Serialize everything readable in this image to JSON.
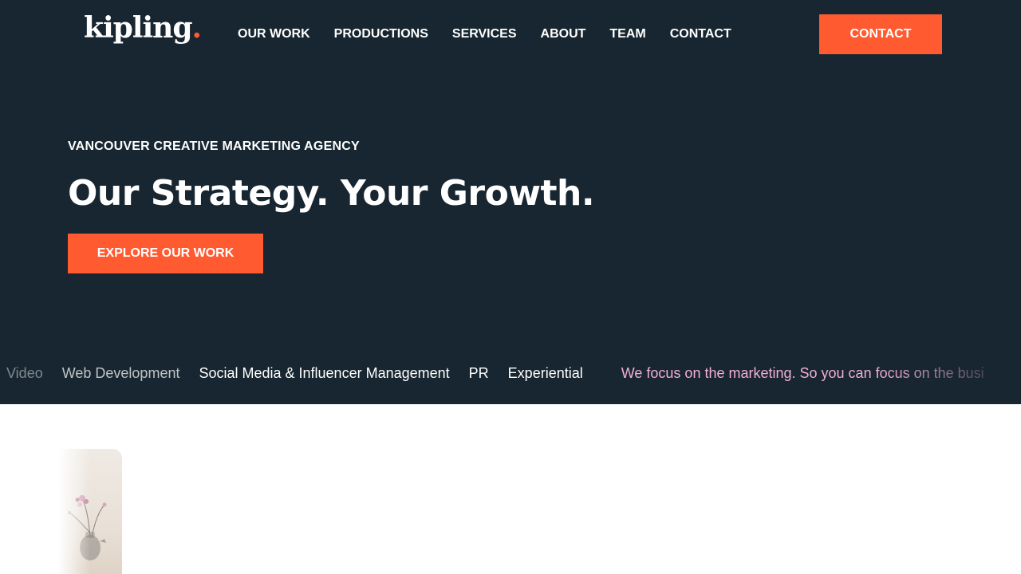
{
  "brand": {
    "name": "kipling",
    "dot": ".",
    "accent_color": "#ff5a30",
    "background_color": "#172630"
  },
  "nav": {
    "items": [
      {
        "label": "OUR WORK"
      },
      {
        "label": "PRODUCTIONS"
      },
      {
        "label": "SERVICES"
      },
      {
        "label": "ABOUT"
      },
      {
        "label": "TEAM"
      },
      {
        "label": "CONTACT"
      }
    ],
    "cta_label": "CONTACT"
  },
  "hero": {
    "eyebrow": "VANCOUVER CREATIVE MARKETING AGENCY",
    "headline": "Our Strategy. Your Growth.",
    "cta_label": "EXPLORE OUR WORK"
  },
  "ticker": {
    "services": [
      "Video",
      "Web Development",
      "Social Media & Influencer Management",
      "PR",
      "Experiential"
    ],
    "tagline": "We focus on the marketing. So you can focus on the busi",
    "tagline_color": "#f3aed4"
  },
  "media": {
    "icon": "flower-vase-image"
  }
}
